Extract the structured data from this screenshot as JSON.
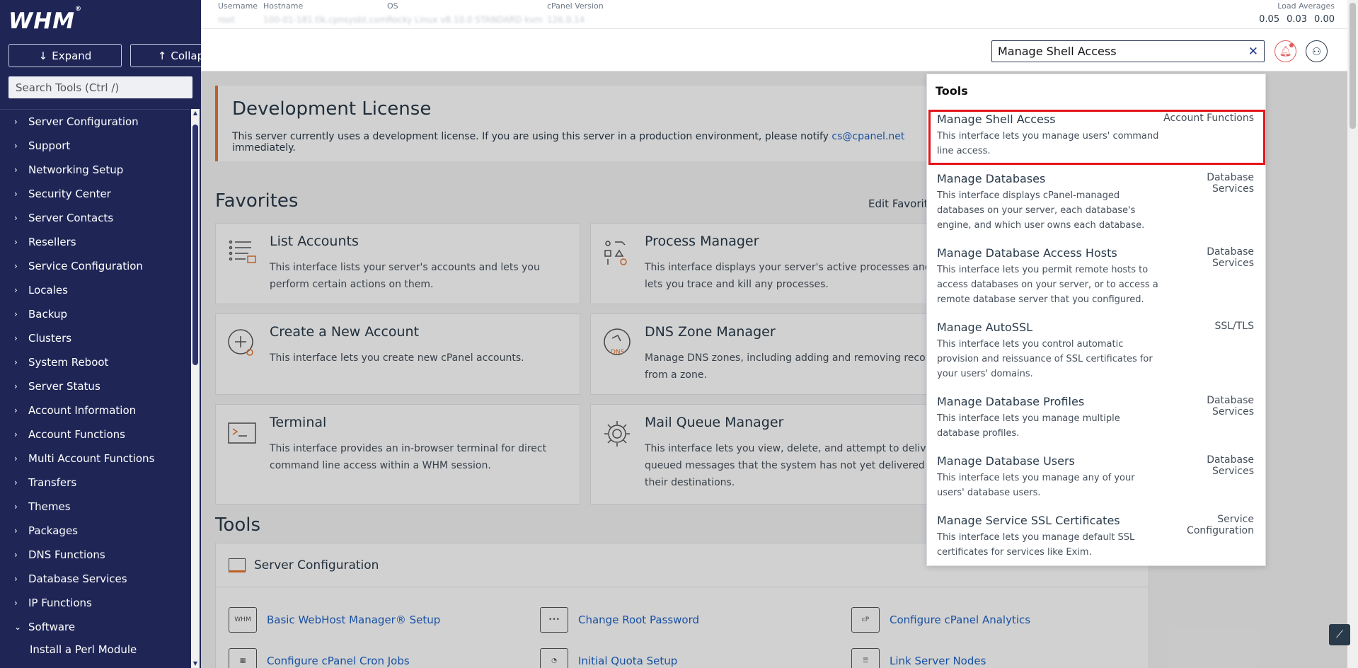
{
  "brand": {
    "logo": "WHM",
    "reg": "®"
  },
  "sidebar": {
    "expand_label": "Expand",
    "collapse_label": "Collapse",
    "search_placeholder": "Search Tools (Ctrl /)",
    "items": [
      {
        "label": "Server Configuration"
      },
      {
        "label": "Support"
      },
      {
        "label": "Networking Setup"
      },
      {
        "label": "Security Center"
      },
      {
        "label": "Server Contacts"
      },
      {
        "label": "Resellers"
      },
      {
        "label": "Service Configuration"
      },
      {
        "label": "Locales"
      },
      {
        "label": "Backup"
      },
      {
        "label": "Clusters"
      },
      {
        "label": "System Reboot"
      },
      {
        "label": "Server Status"
      },
      {
        "label": "Account Information"
      },
      {
        "label": "Account Functions"
      },
      {
        "label": "Multi Account Functions"
      },
      {
        "label": "Transfers"
      },
      {
        "label": "Themes"
      },
      {
        "label": "Packages"
      },
      {
        "label": "DNS Functions"
      },
      {
        "label": "Database Services"
      },
      {
        "label": "IP Functions"
      },
      {
        "label": "Software"
      }
    ],
    "sub_items": [
      {
        "label": "Install a Perl Module"
      }
    ]
  },
  "topbar": {
    "username_label": "Username",
    "username_value": "root",
    "hostname_label": "Hostname",
    "hostname_value": "100-01-181.tlk.cpnsysbt.com",
    "os_label": "OS",
    "os_value": "Rocky Linux v8.10.0 STANDARD kvm",
    "version_label": "cPanel Version",
    "version_value": "126.0.14",
    "load_label": "Load Averages",
    "load_values": [
      "0.05",
      "0.03",
      "0.00"
    ]
  },
  "search": {
    "value": "Manage Shell Access",
    "clear": "✕"
  },
  "license": {
    "title": "Development License",
    "text": "This server currently uses a development license. If you are using this server in a production environment, please notify",
    "link": "cs@cpanel.net",
    "text_after": "immediately."
  },
  "favorites": {
    "title": "Favorites",
    "edit_label": "Edit Favorites",
    "cards": [
      {
        "title": "List Accounts",
        "desc": "This interface lists your server's accounts and lets you perform certain actions on them."
      },
      {
        "title": "Process Manager",
        "desc": "This interface displays your server's active processes and lets you trace and kill any processes."
      },
      {
        "title": "Create a New Account",
        "desc": "This interface lets you create new cPanel accounts."
      },
      {
        "title": "DNS Zone Manager",
        "desc": "Manage DNS zones, including adding and removing records from a zone."
      },
      {
        "title": "Terminal",
        "desc": "This interface provides an in-browser terminal for direct command line access within a WHM session."
      },
      {
        "title": "Mail Queue Manager",
        "desc": "This interface lets you view, delete, and attempt to deliver queued messages that the system has not yet delivered to their destinations."
      }
    ]
  },
  "tools": {
    "title": "Tools",
    "section": "Server Configuration",
    "links": [
      "Basic WebHost Manager® Setup",
      "Change Root Password",
      "Configure cPanel Analytics",
      "Configure cPanel Cron Jobs",
      "Initial Quota Setup",
      "Link Server Nodes"
    ],
    "icon_labels": {
      "whm": "WHM",
      "dns": "DNS",
      "cp": "cP"
    }
  },
  "dropdown": {
    "header": "Tools",
    "results": [
      {
        "name": "Manage Shell Access",
        "desc": "This interface lets you manage users' command line access.",
        "category": "Account Functions"
      },
      {
        "name": "Manage Databases",
        "desc": "This interface displays cPanel-managed databases on your server, each database's engine, and which user owns each database.",
        "category": "Database Services"
      },
      {
        "name": "Manage Database Access Hosts",
        "desc": "This interface lets you permit remote hosts to access databases on your server, or to access a remote database server that you configured.",
        "category": "Database Services"
      },
      {
        "name": "Manage AutoSSL",
        "desc": "This interface lets you control automatic provision and reissuance of SSL certificates for your users' domains.",
        "category": "SSL/TLS"
      },
      {
        "name": "Manage Database Profiles",
        "desc": "This interface lets you manage multiple database profiles.",
        "category": "Database Services"
      },
      {
        "name": "Manage Database Users",
        "desc": "This interface lets you manage any of your users' database users.",
        "category": "Database Services"
      },
      {
        "name": "Manage Service SSL Certificates",
        "desc": "This interface lets you manage default SSL certificates for services like Exim.",
        "category": "Service Configuration"
      }
    ]
  },
  "colors": {
    "sidebar": "#1f2656",
    "accent": "#1f63c6",
    "highlight": "#e4141b",
    "license_border": "#e8762d"
  }
}
